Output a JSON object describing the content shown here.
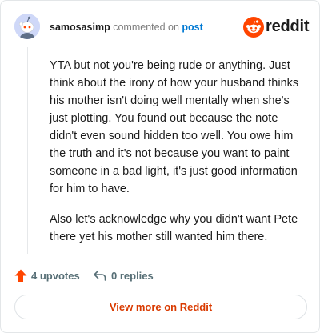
{
  "comment": {
    "username": "samosasimp",
    "commented_on_text": "commented on",
    "post_link_label": "post",
    "paragraphs": [
      "YTA but not you're being rude or anything. Just think about the irony of how your husband thinks his mother isn't doing well mentally when she's just plotting. You found out because the note didn't even sound hidden too well. You owe him the truth and it's not because you want to paint someone in a bad light, it's just good information for him to have.",
      "Also let's acknowledge why you didn't want Pete there yet his mother still wanted him there."
    ],
    "upvotes_label": "4 upvotes",
    "replies_label": "0 replies"
  },
  "brand": {
    "wordmark": "reddit",
    "accent_color": "#ff4500"
  },
  "footer": {
    "view_more_label": "View more on Reddit"
  },
  "icons": {
    "avatar": "snoo-avatar-icon",
    "logo": "reddit-snoo-icon",
    "upvote": "upvote-arrow-icon",
    "reply": "reply-arrow-icon"
  }
}
